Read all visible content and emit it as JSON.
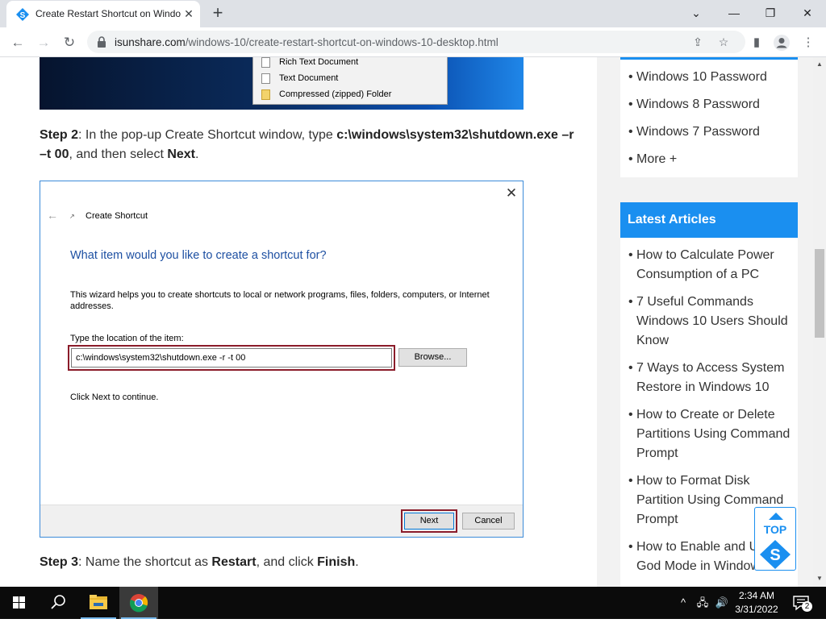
{
  "browser": {
    "tab_title": "Create Restart Shortcut on Windo",
    "url_domain": "isunshare.com",
    "url_path": "/windows-10/create-restart-shortcut-on-windows-10-desktop.html"
  },
  "article": {
    "context_menu": [
      "Rich Text Document",
      "Text Document",
      "Compressed (zipped) Folder"
    ],
    "step2": {
      "label": "Step 2",
      "text1": ": In the pop-up Create Shortcut window, type ",
      "command": "c:\\windows\\system32\\shutdown.exe –r –t 00",
      "text2": ", and then select ",
      "action": "Next",
      "text3": "."
    },
    "dialog": {
      "window_title": "Create Shortcut",
      "heading": "What item would you like to create a shortcut for?",
      "description": "This wizard helps you to create shortcuts to local or network programs, files, folders, computers, or Internet addresses.",
      "location_label": "Type the location of the item:",
      "location_value": "c:\\windows\\system32\\shutdown.exe -r -t 00",
      "browse_label": "Browse...",
      "continue_text": "Click Next to continue.",
      "next_label": "Next",
      "cancel_label": "Cancel"
    },
    "step3": {
      "label": "Step 3",
      "text1": ": Name the shortcut as ",
      "name": "Restart",
      "text2": ", and click ",
      "action": "Finish",
      "text3": "."
    }
  },
  "sidebar": {
    "password_links": [
      "Windows 10 Password",
      "Windows 8 Password",
      "Windows 7 Password",
      "More +"
    ],
    "latest_heading": "Latest Articles",
    "latest_links": [
      "How to Calculate Power Consumption of a PC",
      "7 Useful Commands Windows 10 Users Should Know",
      "7 Ways to Access System Restore in Windows 10",
      "How to Create or Delete Partitions Using Command Prompt",
      "How to Format Disk Partition Using Command Prompt",
      "How to Enable and Use God Mode in Windows"
    ],
    "top_button_label": "TOP",
    "logo_letter": "S"
  },
  "taskbar": {
    "time": "2:34 AM",
    "date": "3/31/2022",
    "notification_count": "2"
  },
  "colors": {
    "accent": "#1a8ff0",
    "highlight_box": "#8b1c2a",
    "dialog_heading": "#1e50a2"
  }
}
